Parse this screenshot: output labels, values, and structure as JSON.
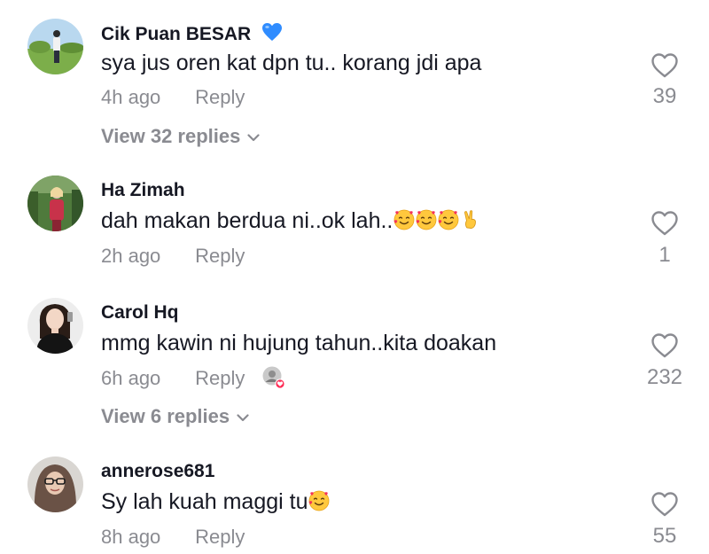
{
  "comments": [
    {
      "username": "Cik Puan BESAR",
      "text": "sya jus oren kat dpn tu.. korang jdi apa",
      "time": "4h ago",
      "reply_label": "Reply",
      "likes": "39",
      "view_replies": "View 32 replies",
      "username_badge": "blue-heart-emoji"
    },
    {
      "username": "Ha Zimah",
      "text": "dah makan berdua ni..ok lah..",
      "emojis": [
        "smiling-face-with-hearts",
        "smiling-face-with-hearts",
        "smiling-face-with-hearts",
        "victory-hand"
      ],
      "time": "2h ago",
      "reply_label": "Reply",
      "likes": "1"
    },
    {
      "username": "Carol Hq",
      "text": "mmg kawin ni hujung tahun..kita doakan",
      "time": "6h ago",
      "reply_label": "Reply",
      "likes": "232",
      "view_replies": "View 6 replies",
      "creator_liked": true
    },
    {
      "username": "annerose681",
      "text": "Sy lah kuah maggi tu",
      "emojis": [
        "smiling-face-with-hearts"
      ],
      "time": "8h ago",
      "reply_label": "Reply",
      "likes": "55"
    }
  ],
  "colors": {
    "text": "#161823",
    "secondary": "#8a8b91",
    "blue_heart": "#2f8cff"
  }
}
